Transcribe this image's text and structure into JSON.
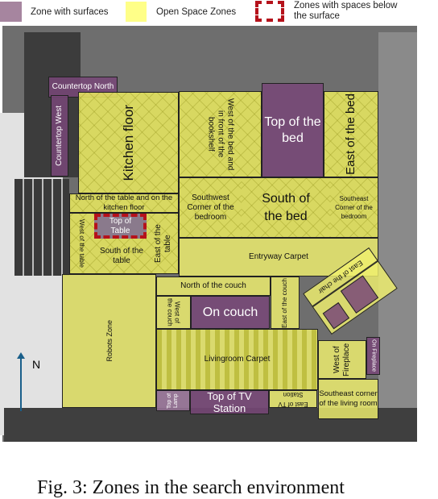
{
  "legend": {
    "surfaces": {
      "label": "Zone with surfaces",
      "color": "#a6859f"
    },
    "open": {
      "label": "Open Space Zones",
      "color": "#ffff88"
    },
    "below": {
      "label_line1": "Zones with spaces below",
      "label_line2": "the surface",
      "color": "#b5121b"
    }
  },
  "zones": {
    "countertop_north": "Countertop North",
    "countertop_west": "Countertop West",
    "kitchen_floor": "Kitchen floor",
    "north_table": "North of the table and on the kitchen floor",
    "top_table": "Top of Table",
    "west_table": "West of the table",
    "south_table": "South of the table",
    "east_table": "East of the table",
    "west_bed": "West of the bed and in front of the bookshelf",
    "top_bed": "Top of the bed",
    "east_bed": "East of the bed",
    "sw_bedroom": "Southwest Corner of the bedroom",
    "south_bed": "South of the bed",
    "se_bedroom": "Southeast Corner of the bedroom",
    "entryway": "Entryway Carpet",
    "robots": "Robots Zone",
    "north_couch": "North of the couch",
    "west_couch": "West of the couch",
    "on_couch": "On couch",
    "east_couch": "East of the couch",
    "east_chair": "East of the chair",
    "livingroom_carpet": "Livingroom Carpet",
    "top_lamp": "Top of Lamp",
    "top_tv": "Top of TV Station",
    "east_tv": "East of TV Station",
    "west_fireplace": "West of Fireplace",
    "on_fireplace": "On Fireplace",
    "se_living": "Southeast corner of the living room"
  },
  "compass": {
    "label": "N",
    "color": "#1a5f8a"
  },
  "caption": "Fig. 3: Zones in the search environment"
}
